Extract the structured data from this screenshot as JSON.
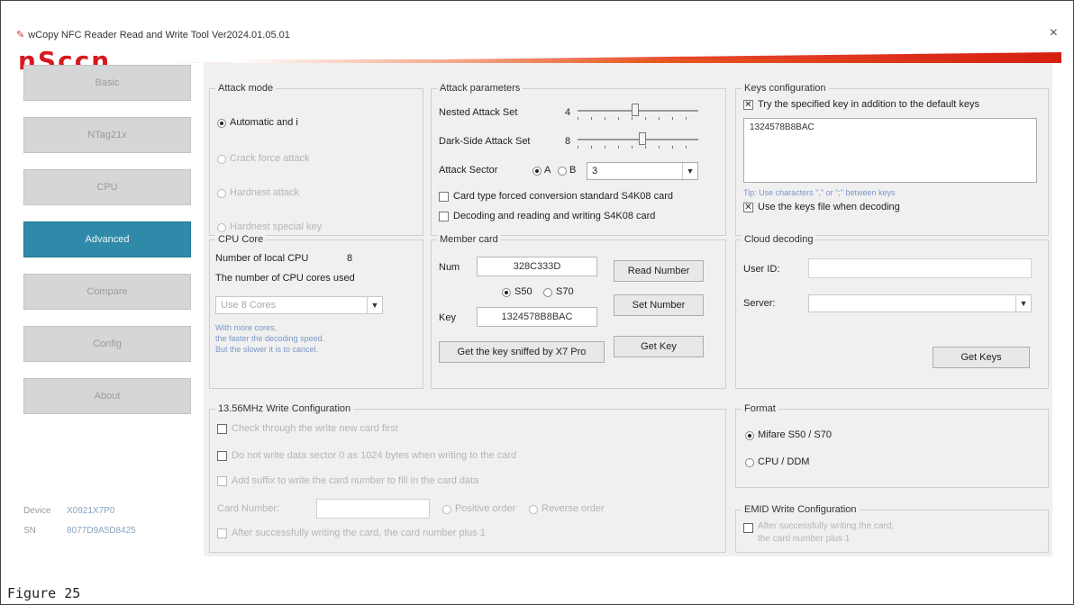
{
  "window": {
    "title": "wCopy NFC Reader Read and Write Tool  Ver2024.01.05.01",
    "close": "×"
  },
  "logo": "nSccn",
  "sidebar": {
    "items": [
      {
        "label": "Basic"
      },
      {
        "label": "NTag21x"
      },
      {
        "label": "CPU"
      },
      {
        "label": "Advanced"
      },
      {
        "label": "Compare"
      },
      {
        "label": "Config"
      },
      {
        "label": "About"
      }
    ],
    "device_label": "Device",
    "device_value": "X0921X7P0",
    "sn_label": "SN",
    "sn_value": "8077D9A5D8425"
  },
  "attack_mode": {
    "title": "Attack mode",
    "options": [
      "Automatic and i",
      "Crack force attack",
      "Hardnest attack",
      "Hardnest special key"
    ]
  },
  "attack_params": {
    "title": "Attack parameters",
    "nested_label": "Nested Attack Set",
    "nested_value": "4",
    "darkside_label": "Dark-Side Attack Set",
    "darkside_value": "8",
    "sector_label": "Attack Sector",
    "opt_a": "A",
    "opt_b": "B",
    "sector_value": "3",
    "chk1": "Card type forced conversion standard S4K08 card",
    "chk2": "Decoding and reading and writing S4K08 card"
  },
  "keys": {
    "title": "Keys configuration",
    "try_label": "Try the specified key in addition to the default keys",
    "key_text": "1324578B8BAC",
    "tip": "Tip: Use characters \",\" or \";\" between keys",
    "use_file": "Use the keys file when decoding"
  },
  "cpu_core": {
    "title": "CPU Core",
    "local_label": "Number of local CPU",
    "local_value": "8",
    "used_label": "The number of CPU cores used",
    "select_value": "Use 8 Cores",
    "hint1": "With more cores,",
    "hint2": "the faster the decoding speed.",
    "hint3": "But the slower it is to cancel."
  },
  "member": {
    "title": "Member card",
    "num_label": "Num",
    "num_value": "328C333D",
    "opt_s50": "S50",
    "opt_s70": "S70",
    "key_label": "Key",
    "key_value": "1324578B8BAC",
    "read_number": "Read Number",
    "set_number": "Set Number",
    "get_key_x7": "Get the key sniffed by X7 Pro",
    "get_key": "Get Key"
  },
  "cloud": {
    "title": "Cloud decoding",
    "user_label": "User ID:",
    "server_label": "Server:",
    "get_keys": "Get Keys"
  },
  "write_config": {
    "title": "13.56MHz Write Configuration",
    "opt1": "Check through the write new card first",
    "opt2": "Do not write data sector 0 as 1024 bytes when writing to the card",
    "opt3": "Add suffix to write the card number to fill in the card data",
    "card_number_label": "Card Number:",
    "pos_order": "Positive order",
    "rev_order": "Reverse order",
    "opt4": "After successfully writing the card, the card number plus 1"
  },
  "format": {
    "title": "Format",
    "opt1": "Mifare S50 / S70",
    "opt2": "CPU / DDM"
  },
  "emid": {
    "title": "EMID Write Configuration",
    "line1": "After successfully writing the card,",
    "line2": "the card number plus 1"
  },
  "caption": "Figure 25"
}
